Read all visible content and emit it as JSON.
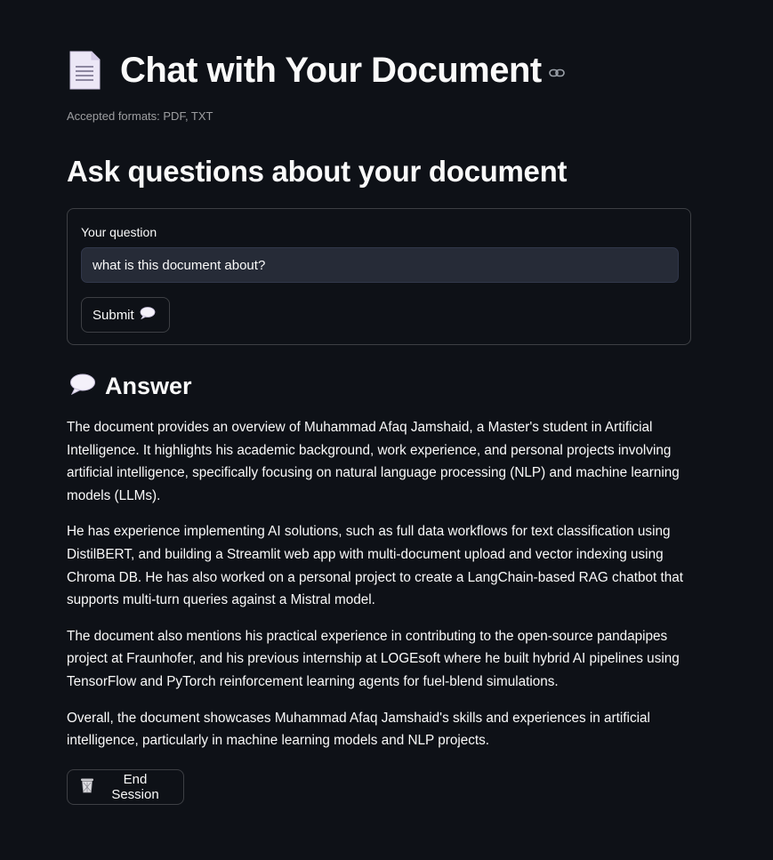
{
  "header": {
    "title": "Chat with Your Document",
    "title_icon": "document-page-icon",
    "anchor_icon": "link-icon",
    "caption": "Accepted formats: PDF, TXT"
  },
  "question_section": {
    "heading": "Ask questions about your document",
    "field_label": "Your question",
    "input_value": "what is this document about?",
    "submit_label": "Submit",
    "submit_icon": "speech-balloon-icon"
  },
  "answer": {
    "icon": "speech-balloon-icon",
    "heading": "Answer",
    "paragraphs": [
      "The document provides an overview of Muhammad Afaq Jamshaid, a Master's student in Artificial Intelligence. It highlights his academic background, work experience, and personal projects involving artificial intelligence, specifically focusing on natural language processing (NLP) and machine learning models (LLMs).",
      "He has experience implementing AI solutions, such as full data workflows for text classification using DistilBERT, and building a Streamlit web app with multi-document upload and vector indexing using Chroma DB. He has also worked on a personal project to create a LangChain-based RAG chatbot that supports multi-turn queries against a Mistral model.",
      "The document also mentions his practical experience in contributing to the open-source pandapipes project at Fraunhofer, and his previous internship at LOGEsoft where he built hybrid AI pipelines using TensorFlow and PyTorch reinforcement learning agents for fuel-blend simulations.",
      "Overall, the document showcases Muhammad Afaq Jamshaid's skills and experiences in artificial intelligence, particularly in machine learning models and NLP projects."
    ]
  },
  "end_session": {
    "label": "End Session",
    "icon": "wastebasket-icon"
  },
  "colors": {
    "background": "#0e1117",
    "text": "#fafafa",
    "input_bg": "#262b37",
    "border": "rgba(250,250,250,0.2)"
  }
}
